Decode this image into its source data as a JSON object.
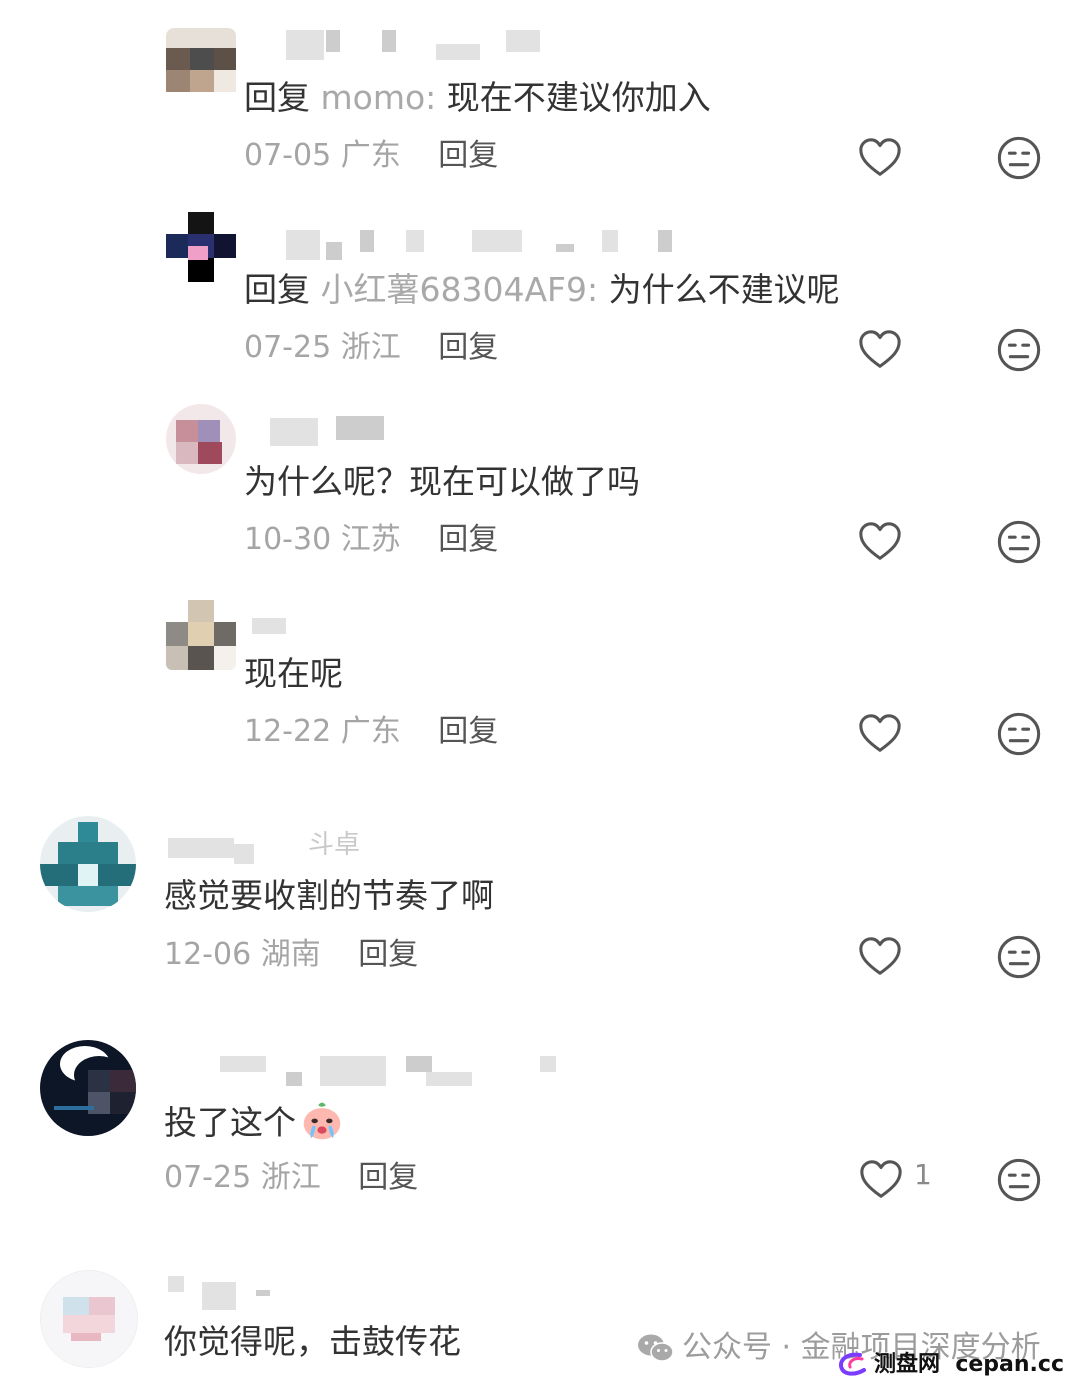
{
  "comments": [
    {
      "reply_prefix": "回复",
      "reply_target": "momo:",
      "text": "现在不建议你加入",
      "date": "07-05",
      "location": "广东",
      "reply_label": "回复"
    },
    {
      "reply_prefix": "回复",
      "reply_target": "小红薯68304AF9:",
      "text": "为什么不建议呢",
      "date": "07-25",
      "location": "浙江",
      "reply_label": "回复"
    },
    {
      "text": "为什么呢？现在可以做了吗",
      "date": "10-30",
      "location": "江苏",
      "reply_label": "回复"
    },
    {
      "text": "现在呢",
      "date": "12-22",
      "location": "广东",
      "reply_label": "回复"
    },
    {
      "author_suffix": "斗卓",
      "text": "感觉要收割的节奏了啊",
      "date": "12-06",
      "location": "湖南",
      "reply_label": "回复"
    },
    {
      "text": "投了这个",
      "date": "07-25",
      "location": "浙江",
      "reply_label": "回复",
      "like_count": "1"
    },
    {
      "text": "你觉得呢，击鼓传花"
    }
  ],
  "icons": {
    "like": "heart-outline-icon",
    "dislike": "neutral-face-icon",
    "emoji": "crying-peach-emoji",
    "watermark": "wechat-icon"
  },
  "watermark": {
    "text": "公众号 · 金融项目深度分析"
  },
  "site_badge": {
    "name": "测盘网",
    "domain": "cepan.cc"
  },
  "colors": {
    "text": "#333333",
    "meta": "#a5a5a5",
    "reply_target": "#a9a9a9",
    "icon": "#555555"
  }
}
